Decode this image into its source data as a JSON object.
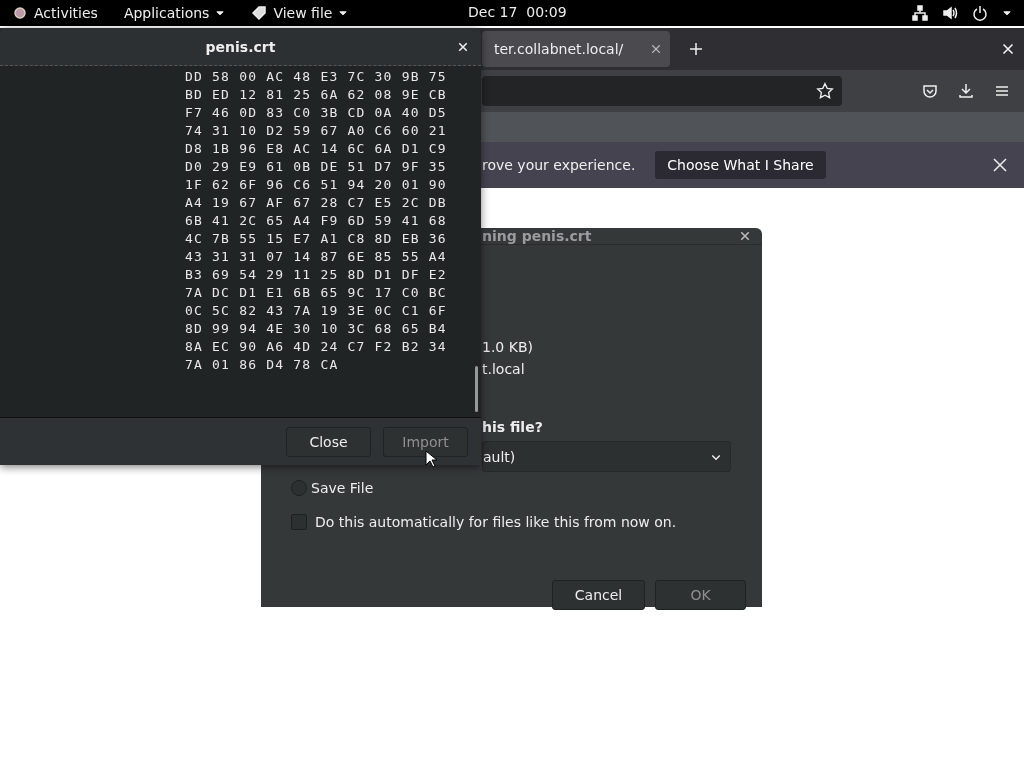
{
  "top_bar": {
    "activities": "Activities",
    "applications_menu": "Applications",
    "app_menu": "View file",
    "clock": "Dec 17  00:09"
  },
  "browser": {
    "tab": {
      "title": "ter.collabnet.local/",
      "selected": true
    },
    "notification": {
      "text": "rove your experience.",
      "button": "Choose What I Share"
    }
  },
  "download_dialog": {
    "title": "ning penis.crt",
    "info_lines": [
      "1.0 KB)",
      "t.local"
    ],
    "question": "his file?",
    "open_with": "ault)",
    "options": [
      {
        "label": "Save File",
        "selected": false
      }
    ],
    "remember": {
      "label": "Do this automatically for files like this from now on.",
      "checked": false
    },
    "buttons": [
      {
        "label": "Cancel",
        "disabled": false
      },
      {
        "label": "OK",
        "disabled": true
      }
    ]
  },
  "hex_viewer": {
    "title": "penis.crt",
    "rows": [
      "DD 58 00 AC 48 E3 7C 30 9B 75",
      "BD ED 12 81 25 6A 62 08 9E CB",
      "F7 46 0D 83 C0 3B CD 0A 40 D5",
      "74 31 10 D2 59 67 A0 C6 60 21",
      "D8 1B 96 E8 AC 14 6C 6A D1 C9",
      "D0 29 E9 61 0B DE 51 D7 9F 35",
      "1F 62 6F 96 C6 51 94 20 01 90",
      "A4 19 67 AF 67 28 C7 E5 2C DB",
      "6B 41 2C 65 A4 F9 6D 59 41 68",
      "4C 7B 55 15 E7 A1 C8 8D EB 36",
      "43 31 31 07 14 87 6E 85 55 A4",
      "B3 69 54 29 11 25 8D D1 DF E2",
      "7A DC D1 E1 6B 65 9C 17 C0 BC",
      "0C 5C 82 43 7A 19 3E 0C C1 6F",
      "8D 99 94 4E 30 10 3C 68 65 B4",
      "8A EC 90 A6 4D 24 C7 F2 B2 34",
      "7A 01 86 D4 78 CA"
    ],
    "buttons": [
      {
        "label": "Close",
        "disabled": false
      },
      {
        "label": "Import",
        "disabled": true
      }
    ]
  }
}
